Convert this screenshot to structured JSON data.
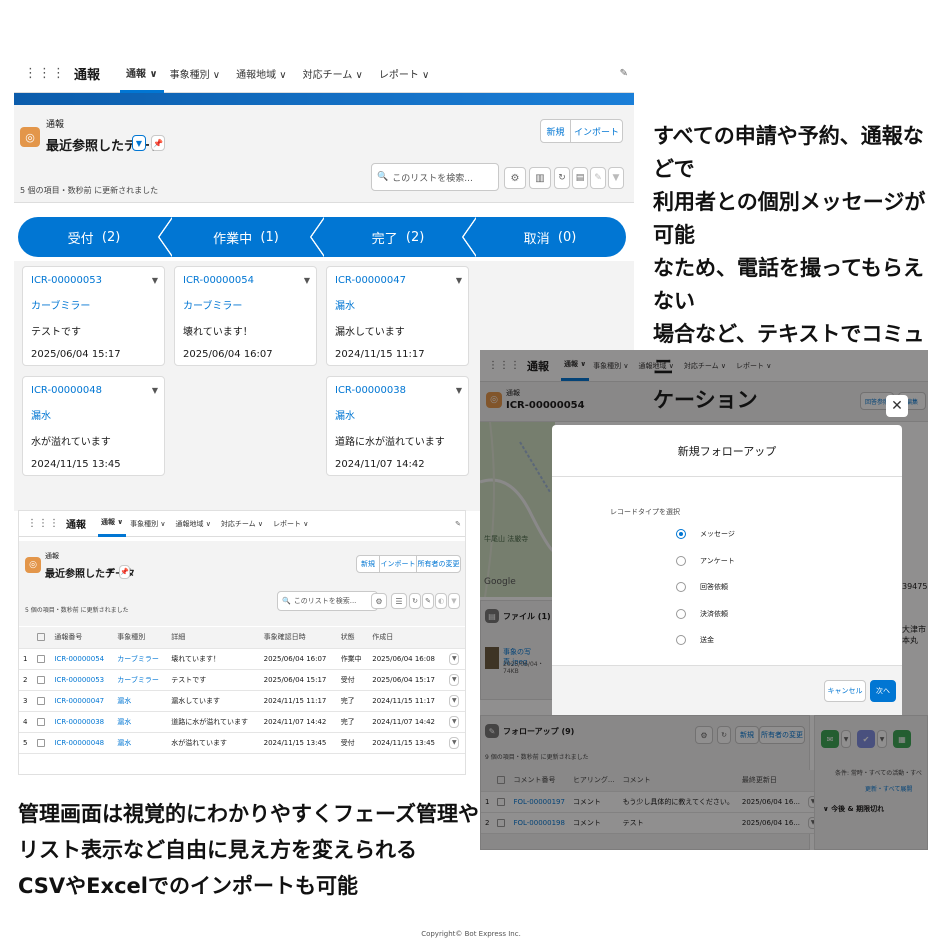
{
  "nav": {
    "app": "通報",
    "tabs": [
      "通報 ∨",
      "事象種別 ∨",
      "通報地域 ∨",
      "対応チーム ∨",
      "レポート ∨"
    ]
  },
  "screen1": {
    "object_label": "通報",
    "list_title": "最近参照したデータ",
    "btn_new": "新規",
    "btn_import": "インポート",
    "status": "5 個の項目・数秒前 に更新されました",
    "search_placeholder": "このリストを検索...",
    "stages": [
      {
        "label": "受付",
        "count": "(2)"
      },
      {
        "label": "作業中",
        "count": "(1)"
      },
      {
        "label": "完了",
        "count": "(2)"
      },
      {
        "label": "取消",
        "count": "(0)"
      }
    ],
    "cards": [
      {
        "id": "ICR-00000053",
        "type": "カーブミラー",
        "detail": "テストです",
        "date": "2025/06/04 15:17"
      },
      {
        "id": "ICR-00000048",
        "type": "漏水",
        "detail": "水が溢れています",
        "date": "2024/11/15 13:45"
      },
      {
        "id": "ICR-00000054",
        "type": "カーブミラー",
        "detail": "壊れています！",
        "date": "2025/06/04 16:07"
      },
      {
        "id": "ICR-00000047",
        "type": "漏水",
        "detail": "漏水しています",
        "date": "2024/11/15 11:17"
      },
      {
        "id": "ICR-00000038",
        "type": "漏水",
        "detail": "道路に水が溢れています",
        "date": "2024/11/07 14:42"
      }
    ]
  },
  "screen2": {
    "object_label": "通報",
    "list_title": "最近参照したデータ",
    "btn_new": "新規",
    "btn_import": "インポート",
    "btn_owner": "所有者の変更",
    "status": "5 個の項目・数秒前 に更新されました",
    "search_placeholder": "このリストを検索...",
    "columns": [
      "通報番号",
      "事象種別",
      "詳細",
      "事象確認日時",
      "状態",
      "作成日"
    ],
    "rows": [
      {
        "n": "1",
        "id": "ICR-00000054",
        "type": "カーブミラー",
        "detail": "壊れています！",
        "confirmed": "2025/06/04 16:07",
        "state": "作業中",
        "created": "2025/06/04 16:08"
      },
      {
        "n": "2",
        "id": "ICR-00000053",
        "type": "カーブミラー",
        "detail": "テストです",
        "confirmed": "2025/06/04 15:17",
        "state": "受付",
        "created": "2025/06/04 15:17"
      },
      {
        "n": "3",
        "id": "ICR-00000047",
        "type": "漏水",
        "detail": "漏水しています",
        "confirmed": "2024/11/15 11:17",
        "state": "完了",
        "created": "2024/11/15 11:17"
      },
      {
        "n": "4",
        "id": "ICR-00000038",
        "type": "漏水",
        "detail": "道路に水が溢れています",
        "confirmed": "2024/11/07 14:42",
        "state": "完了",
        "created": "2024/11/07 14:42"
      },
      {
        "n": "5",
        "id": "ICR-00000048",
        "type": "漏水",
        "detail": "水が溢れています",
        "confirmed": "2024/11/15 13:45",
        "state": "受付",
        "created": "2024/11/15 13:45"
      }
    ]
  },
  "screen3": {
    "object_label": "通報",
    "record_id": "ICR-00000054",
    "btn_reply": "回答参照",
    "btn_edit": "編集",
    "map_label": "Google",
    "map_place": "牛尾山 法厳寺",
    "side_text_1": "39475911",
    "side_text_2": "大津市本丸",
    "files_title": "ファイル (1)",
    "file_name": "事象の写真.jpeg",
    "file_meta": "2025/06/04・74KB",
    "followup_title": "フォローアップ (9)",
    "followup_status": "9 個の項目・数秒前 に更新されました",
    "followup_btn_new": "新規",
    "followup_btn_owner": "所有者の変更",
    "followup_columns": [
      "コメント番号",
      "ヒアリング...",
      "コメント",
      "最終更新日"
    ],
    "followup_rows": [
      {
        "n": "1",
        "id": "FOL-00000197",
        "kind": "コメント",
        "comment": "もう少し具体的に教えてください。",
        "date": "2025/06/04 16..."
      },
      {
        "n": "2",
        "id": "FOL-00000198",
        "kind": "コメント",
        "comment": "テスト",
        "date": "2025/06/04 16..."
      }
    ],
    "right_filter": "条件: 常時・すべての活動・すべ",
    "right_links": "更新・すべて展開",
    "right_section": "今後 & 期限切れ",
    "modal": {
      "title": "新規フォローアップ",
      "record_type_label": "レコードタイプを選択",
      "options": [
        "メッセージ",
        "アンケート",
        "回答依頼",
        "決済依頼",
        "送金"
      ],
      "cancel": "キャンセル",
      "next": "次へ"
    }
  },
  "captions": {
    "right_lines": [
      "すべての申請や予約、通報などで",
      "利用者との個別メッセージが可能",
      "なため、電話を撮ってもらえない",
      "場合など、テキストでコミュニ",
      "ケーション"
    ],
    "bottom_lines": [
      "管理画面は視覚的にわかりやすくフェーズ管理や",
      "リスト表示など自由に見え方を変えられる",
      "CSVやExcelでのインポートも可能"
    ],
    "copyright": "Copyright© Bot Express Inc."
  }
}
